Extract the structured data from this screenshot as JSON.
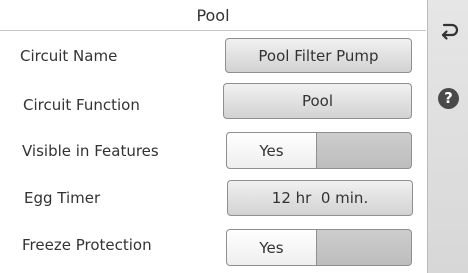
{
  "header": {
    "title": "Pool"
  },
  "side_rail": {
    "back_icon": "back-arrow-icon",
    "help_icon": "help-icon",
    "help_glyph": "?"
  },
  "rows": {
    "circuit_name": {
      "label": "Circuit Name",
      "value": "Pool Filter Pump"
    },
    "circuit_function": {
      "label": "Circuit Function",
      "value": "Pool"
    },
    "visible_in_features": {
      "label": "Visible in Features",
      "value": "Yes"
    },
    "egg_timer": {
      "label": "Egg Timer",
      "value": "12 hr  0 min."
    },
    "freeze_protection": {
      "label": "Freeze Protection",
      "value": "Yes"
    }
  }
}
